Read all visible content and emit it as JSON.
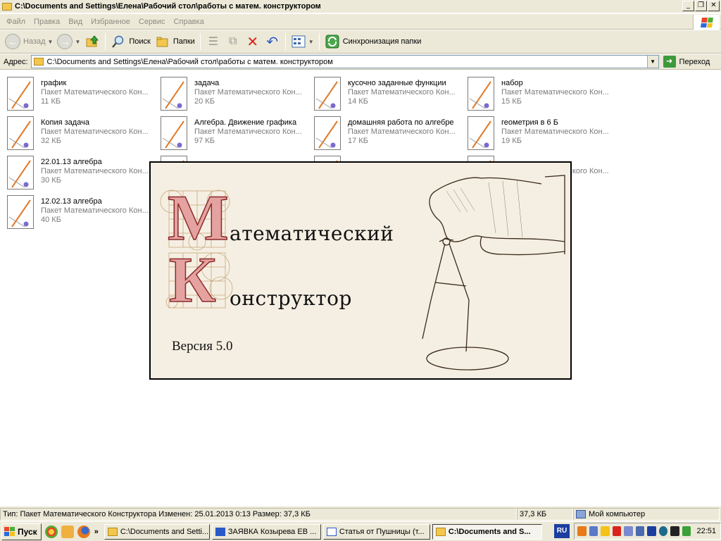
{
  "window": {
    "title": "C:\\Documents and Settings\\Елена\\Рабочий стол\\работы с матем. конструктором",
    "controls": {
      "minimize": "_",
      "maximize": "❐",
      "close": "✕"
    }
  },
  "menu": [
    "Файл",
    "Правка",
    "Вид",
    "Избранное",
    "Сервис",
    "Справка"
  ],
  "toolbar": {
    "back_label": "Назад",
    "search_label": "Поиск",
    "folders_label": "Папки",
    "sync_label": "Синхронизация папки"
  },
  "address": {
    "label": "Адрес:",
    "value": "C:\\Documents and Settings\\Елена\\Рабочий стол\\работы с матем. конструктором",
    "go_label": "Переход"
  },
  "files": [
    {
      "name": "график",
      "type": "Пакет Математического Кон...",
      "size": "11 КБ"
    },
    {
      "name": "задача",
      "type": "Пакет Математического Кон...",
      "size": "20 КБ"
    },
    {
      "name": "кусочно заданные функции",
      "type": "Пакет Математического Кон...",
      "size": "14 КБ"
    },
    {
      "name": "набор",
      "type": "Пакет Математического Кон...",
      "size": "15 КБ"
    },
    {
      "name": "Копия задача",
      "type": "Пакет Математического Кон...",
      "size": "32 КБ"
    },
    {
      "name": "Алгебра. Движение графика",
      "type": "Пакет Математического Кон...",
      "size": "97 КБ"
    },
    {
      "name": "домашняя работа по алгебре",
      "type": "Пакет Математического Кон...",
      "size": "17 КБ"
    },
    {
      "name": "геометрия в 6 Б",
      "type": "Пакет Математического Кон...",
      "size": "19 КБ"
    },
    {
      "name": "22.01.13 алгебра",
      "type": "Пакет Математического Кон...",
      "size": "30 КБ"
    },
    {
      "name": "",
      "type": "",
      "size": ""
    },
    {
      "name": "",
      "type": "",
      "size": ""
    },
    {
      "name": "",
      "type": "Пакет Математического Кон...",
      "size": ""
    },
    {
      "name": "12.02.13 алгебра",
      "type": "Пакет Математического Кон...",
      "size": "40 КБ"
    }
  ],
  "splash": {
    "title_line1": "атематический",
    "title_line2": "онструктор",
    "initial1": "М",
    "initial2": "К",
    "version": "Версия 5.0"
  },
  "status": {
    "info": "Тип: Пакет Математического Конструктора Изменен: 25.01.2013 0:13 Размер: 37,3 КБ",
    "size": "37,3 КБ",
    "location": "Мой компьютер"
  },
  "taskbar": {
    "start_label": "Пуск",
    "more": "»",
    "tasks": [
      {
        "label": "C:\\Documents and Setti...",
        "active": false
      },
      {
        "label": "ЗАЯВКА Козырева ЕВ ...",
        "active": false
      },
      {
        "label": "Статья от Пушницы (т...",
        "active": false
      },
      {
        "label": "C:\\Documents and S...",
        "active": true
      }
    ],
    "language": "RU",
    "clock": "22:51"
  },
  "colors": {
    "chrome": "#ece9d8",
    "splash_bg": "#f5efe3",
    "letter_fill": "#e4a3a0",
    "file_icon_line": "#e07a2a",
    "file_icon_dot": "#7a6ad0"
  }
}
